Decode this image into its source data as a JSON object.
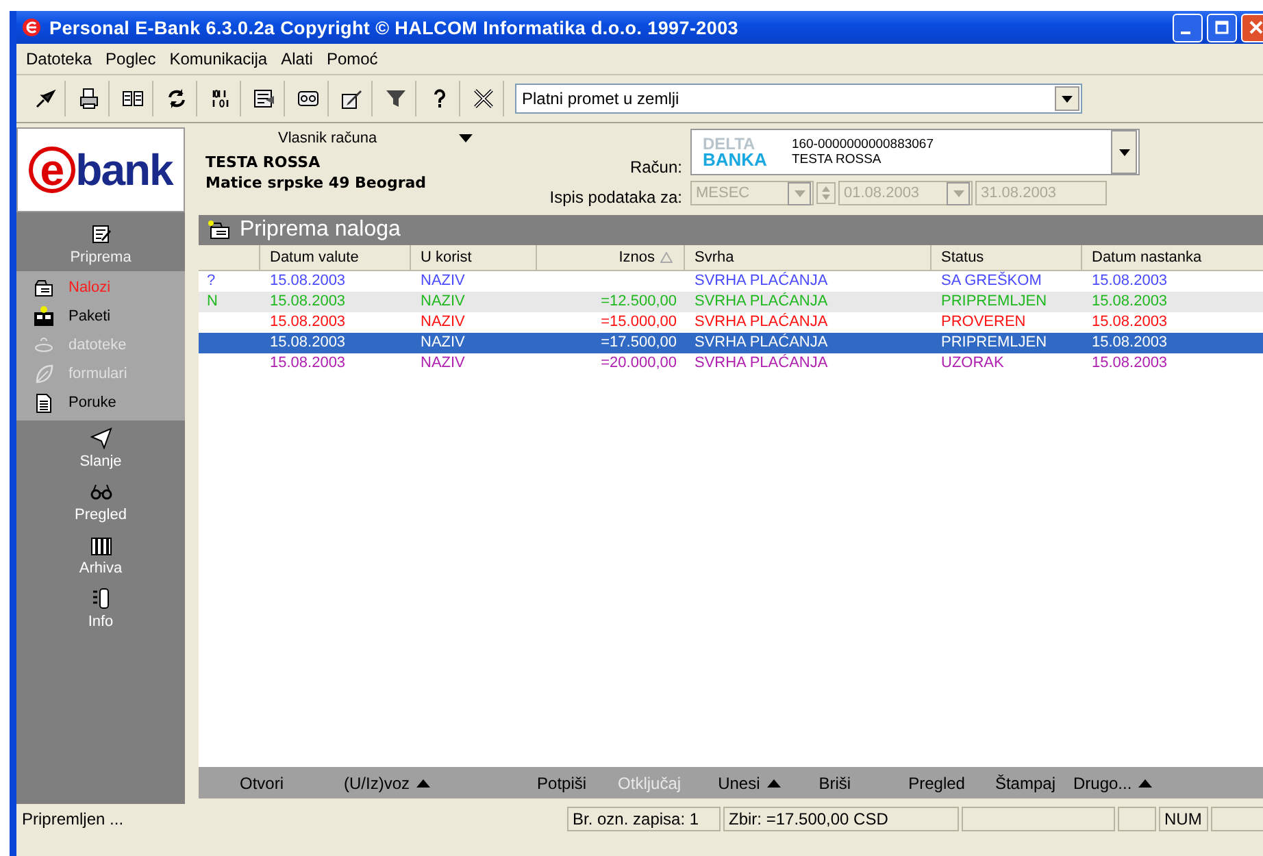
{
  "window": {
    "title": "Personal E-Bank 6.3.0.2a Copyright © HALCOM Informatika d.o.o. 1997-2003"
  },
  "menu": [
    "Datoteka",
    "Poglec",
    "Komunikacija",
    "Alati",
    "Pomoć"
  ],
  "toolbar": {
    "combo": "Platni promet u zemlji"
  },
  "owner": {
    "label": "Vlasnik računa",
    "name": "TESTA ROSSA",
    "address": "Matice srpske 49 Beograd"
  },
  "account": {
    "label": "Račun:",
    "bank_logo": [
      "DELTA",
      "BANKA"
    ],
    "number": "160-0000000000883067",
    "holder": "TESTA ROSSA"
  },
  "period": {
    "label": "Ispis podataka za:",
    "type": "MESEC",
    "from": "01.08.2003",
    "to": "31.08.2003",
    "disabled": true
  },
  "sidebar": {
    "logo": {
      "letter": "e",
      "word": "bank"
    },
    "sections": [
      {
        "label": "Priprema",
        "expanded": true,
        "children": [
          {
            "label": "Nalozi",
            "selected": true,
            "disabled": false
          },
          {
            "label": "Paketi",
            "selected": false,
            "disabled": false
          },
          {
            "label": "datoteke",
            "selected": false,
            "disabled": true
          },
          {
            "label": "formulari",
            "selected": false,
            "disabled": true
          },
          {
            "label": "Poruke",
            "selected": false,
            "disabled": false
          }
        ]
      },
      {
        "label": "Slanje",
        "expanded": false
      },
      {
        "label": "Pregled",
        "expanded": false
      },
      {
        "label": "Arhiva",
        "expanded": false
      },
      {
        "label": "Info",
        "expanded": false
      }
    ]
  },
  "panel": {
    "title": "Priprema naloga"
  },
  "table": {
    "columns": [
      {
        "label": "Datum valute",
        "sorted": false
      },
      {
        "label": "U korist",
        "sorted": false
      },
      {
        "label": "Iznos",
        "sorted": true
      },
      {
        "label": "Svrha",
        "sorted": false
      },
      {
        "label": "Status",
        "sorted": false
      },
      {
        "label": "Datum nastanka",
        "sorted": false
      }
    ],
    "rows": [
      {
        "mark": "?",
        "cells": [
          "15.08.2003",
          "NAZIV",
          "",
          "SVRHA PLAĆANJA",
          "SA GREŠKOM",
          "15.08.2003"
        ],
        "color": "#4a4aff",
        "selected": false,
        "shaded": false
      },
      {
        "mark": "N",
        "cells": [
          "15.08.2003",
          "NAZIV",
          "=12.500,00",
          "SVRHA PLAĆANJA",
          "PRIPREMLJEN",
          "15.08.2003"
        ],
        "color": "#1fb81f",
        "selected": false,
        "shaded": true
      },
      {
        "cells": [
          "15.08.2003",
          "NAZIV",
          "=15.000,00",
          "SVRHA PLAĆANJA",
          "PROVEREN",
          "15.08.2003"
        ],
        "color": "#ff1010",
        "selected": false,
        "shaded": false
      },
      {
        "cells": [
          "15.08.2003",
          "NAZIV",
          "=17.500,00",
          "SVRHA PLAĆANJA",
          "PRIPREMLJEN",
          "15.08.2003"
        ],
        "selected": true,
        "shaded": false
      },
      {
        "cells": [
          "15.08.2003",
          "NAZIV",
          "=20.000,00",
          "SVRHA PLAĆANJA",
          "UZORAK",
          "15.08.2003"
        ],
        "color": "#b020b0",
        "selected": false,
        "shaded": false
      }
    ]
  },
  "actions": [
    {
      "label": "Otvori",
      "menu": false,
      "disabled": false
    },
    {
      "label": "(U/Iz)voz",
      "menu": true,
      "disabled": false
    },
    {
      "label": "Potpiši",
      "menu": false,
      "disabled": false
    },
    {
      "label": "Otključaj",
      "menu": false,
      "disabled": true
    },
    {
      "label": "Unesi",
      "menu": true,
      "disabled": false
    },
    {
      "label": "Briši",
      "menu": false,
      "disabled": false
    },
    {
      "label": "Pregled",
      "menu": false,
      "disabled": false
    },
    {
      "label": "Štampaj",
      "menu": false,
      "disabled": false
    },
    {
      "label": "Drugo...",
      "menu": true,
      "disabled": false
    }
  ],
  "status_bar": {
    "message": "Pripremljen ...",
    "records": "Br. ozn. zapisa: 1",
    "sum": "Zbir: =17.500,00 CSD",
    "num": "NUM"
  }
}
